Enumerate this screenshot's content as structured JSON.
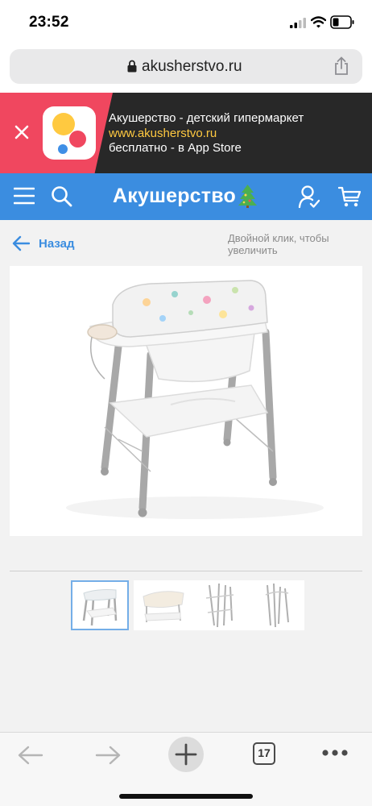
{
  "status_bar": {
    "time": "23:52",
    "icons": [
      "signal-icon",
      "wifi-icon",
      "battery-icon"
    ]
  },
  "browser": {
    "url": "akusherstvo.ru",
    "icons": [
      "lock-icon",
      "share-icon"
    ]
  },
  "app_banner": {
    "title": "Акушерство - детский гипермаркет",
    "link": "www.akusherstvo.ru",
    "subtitle": "бесплатно - в App Store",
    "colors": {
      "accent": "#f0475f",
      "background": "#282828",
      "link": "#ffc940"
    }
  },
  "site_nav": {
    "brand": "Акушерство",
    "icons": [
      "menu-icon",
      "search-icon",
      "tree-icon",
      "user-icon",
      "cart-icon"
    ],
    "color": "#3b8de0"
  },
  "page": {
    "back_label": "Назад",
    "zoom_hint": "Двойной клик, чтобы увеличить"
  },
  "gallery": {
    "thumbnails": [
      "thumbnail-1",
      "thumbnail-2",
      "thumbnail-3",
      "thumbnail-4"
    ],
    "active_index": 0
  },
  "toolbar": {
    "tab_count": "17",
    "icons": [
      "back-icon",
      "forward-icon",
      "plus-icon",
      "tabs-icon",
      "more-icon"
    ]
  }
}
